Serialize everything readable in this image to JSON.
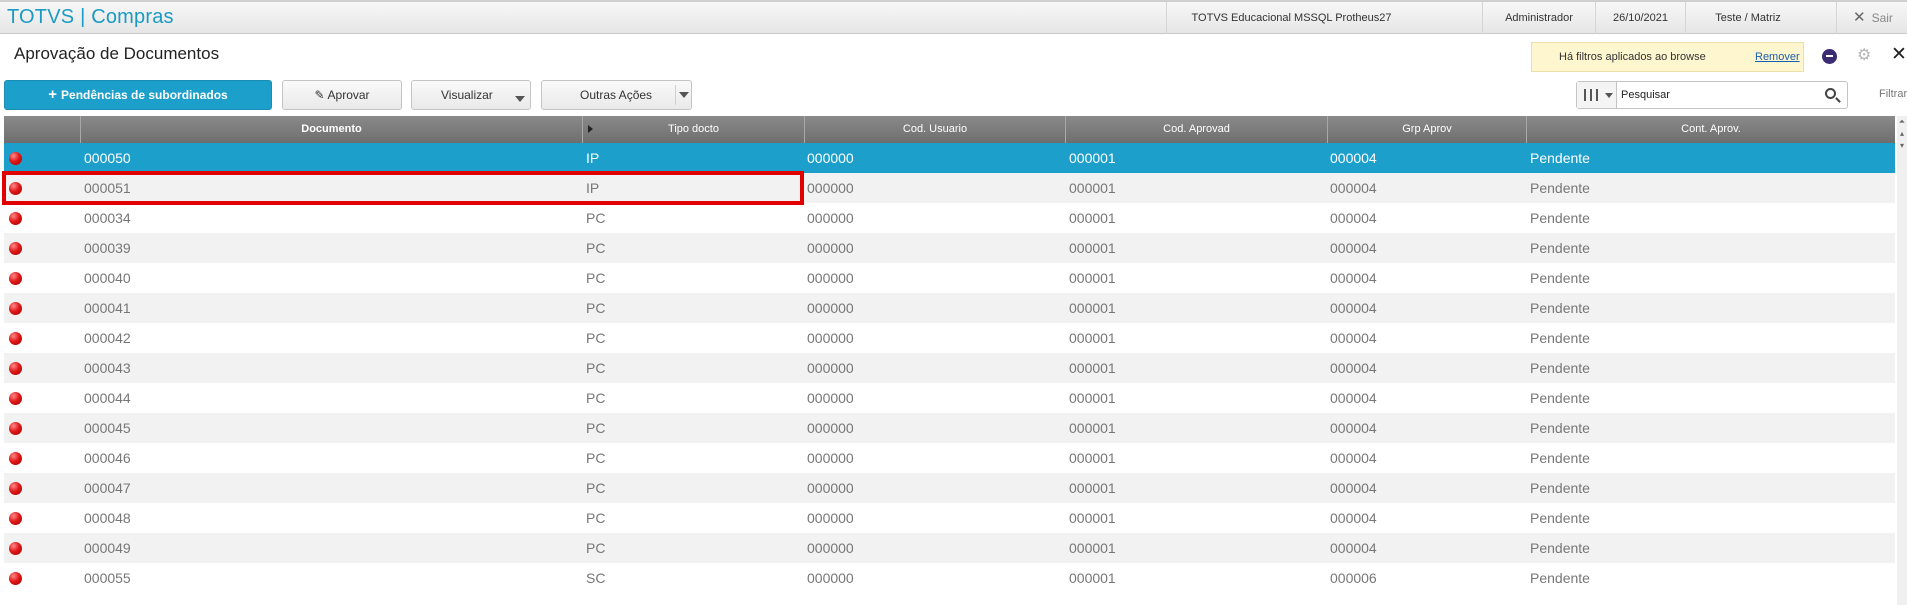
{
  "app": {
    "title": "TOTVS | Compras",
    "environment": "TOTVS Educacional MSSQL Protheus27",
    "user": "Administrador",
    "date": "26/10/2021",
    "branch": "Teste / Matriz",
    "exit_label": "Sair"
  },
  "page": {
    "title": "Aprovação de Documentos",
    "filter_notice": "Há filtros aplicados ao browse",
    "filter_remove": "Remover"
  },
  "toolbar": {
    "subordinates_label": "Pendências de subordinados",
    "approve_label": "Aprovar",
    "view_label": "Visualizar",
    "other_actions_label": "Outras Ações",
    "search_placeholder": "Pesquisar",
    "filter_label": "Filtrar"
  },
  "colors": {
    "accent": "#1d9fcb",
    "status_pending": "#e11919",
    "highlight": "#e00000"
  },
  "grid": {
    "columns": [
      "",
      "Documento",
      "Tipo docto",
      "Cod. Usuario",
      "Cod. Aprovad",
      "Grp Aprov",
      "Cont. Aprov."
    ],
    "selected_row": 0,
    "highlighted_row": 1,
    "rows": [
      {
        "documento": "000050",
        "tipo": "IP",
        "usuario": "000000",
        "aprovad": "000001",
        "grp": "000004",
        "status": "Pendente"
      },
      {
        "documento": "000051",
        "tipo": "IP",
        "usuario": "000000",
        "aprovad": "000001",
        "grp": "000004",
        "status": "Pendente"
      },
      {
        "documento": "000034",
        "tipo": "PC",
        "usuario": "000000",
        "aprovad": "000001",
        "grp": "000004",
        "status": "Pendente"
      },
      {
        "documento": "000039",
        "tipo": "PC",
        "usuario": "000000",
        "aprovad": "000001",
        "grp": "000004",
        "status": "Pendente"
      },
      {
        "documento": "000040",
        "tipo": "PC",
        "usuario": "000000",
        "aprovad": "000001",
        "grp": "000004",
        "status": "Pendente"
      },
      {
        "documento": "000041",
        "tipo": "PC",
        "usuario": "000000",
        "aprovad": "000001",
        "grp": "000004",
        "status": "Pendente"
      },
      {
        "documento": "000042",
        "tipo": "PC",
        "usuario": "000000",
        "aprovad": "000001",
        "grp": "000004",
        "status": "Pendente"
      },
      {
        "documento": "000043",
        "tipo": "PC",
        "usuario": "000000",
        "aprovad": "000001",
        "grp": "000004",
        "status": "Pendente"
      },
      {
        "documento": "000044",
        "tipo": "PC",
        "usuario": "000000",
        "aprovad": "000001",
        "grp": "000004",
        "status": "Pendente"
      },
      {
        "documento": "000045",
        "tipo": "PC",
        "usuario": "000000",
        "aprovad": "000001",
        "grp": "000004",
        "status": "Pendente"
      },
      {
        "documento": "000046",
        "tipo": "PC",
        "usuario": "000000",
        "aprovad": "000001",
        "grp": "000004",
        "status": "Pendente"
      },
      {
        "documento": "000047",
        "tipo": "PC",
        "usuario": "000000",
        "aprovad": "000001",
        "grp": "000004",
        "status": "Pendente"
      },
      {
        "documento": "000048",
        "tipo": "PC",
        "usuario": "000000",
        "aprovad": "000001",
        "grp": "000004",
        "status": "Pendente"
      },
      {
        "documento": "000049",
        "tipo": "PC",
        "usuario": "000000",
        "aprovad": "000001",
        "grp": "000004",
        "status": "Pendente"
      },
      {
        "documento": "000055",
        "tipo": "SC",
        "usuario": "000000",
        "aprovad": "000001",
        "grp": "000006",
        "status": "Pendente"
      }
    ]
  }
}
